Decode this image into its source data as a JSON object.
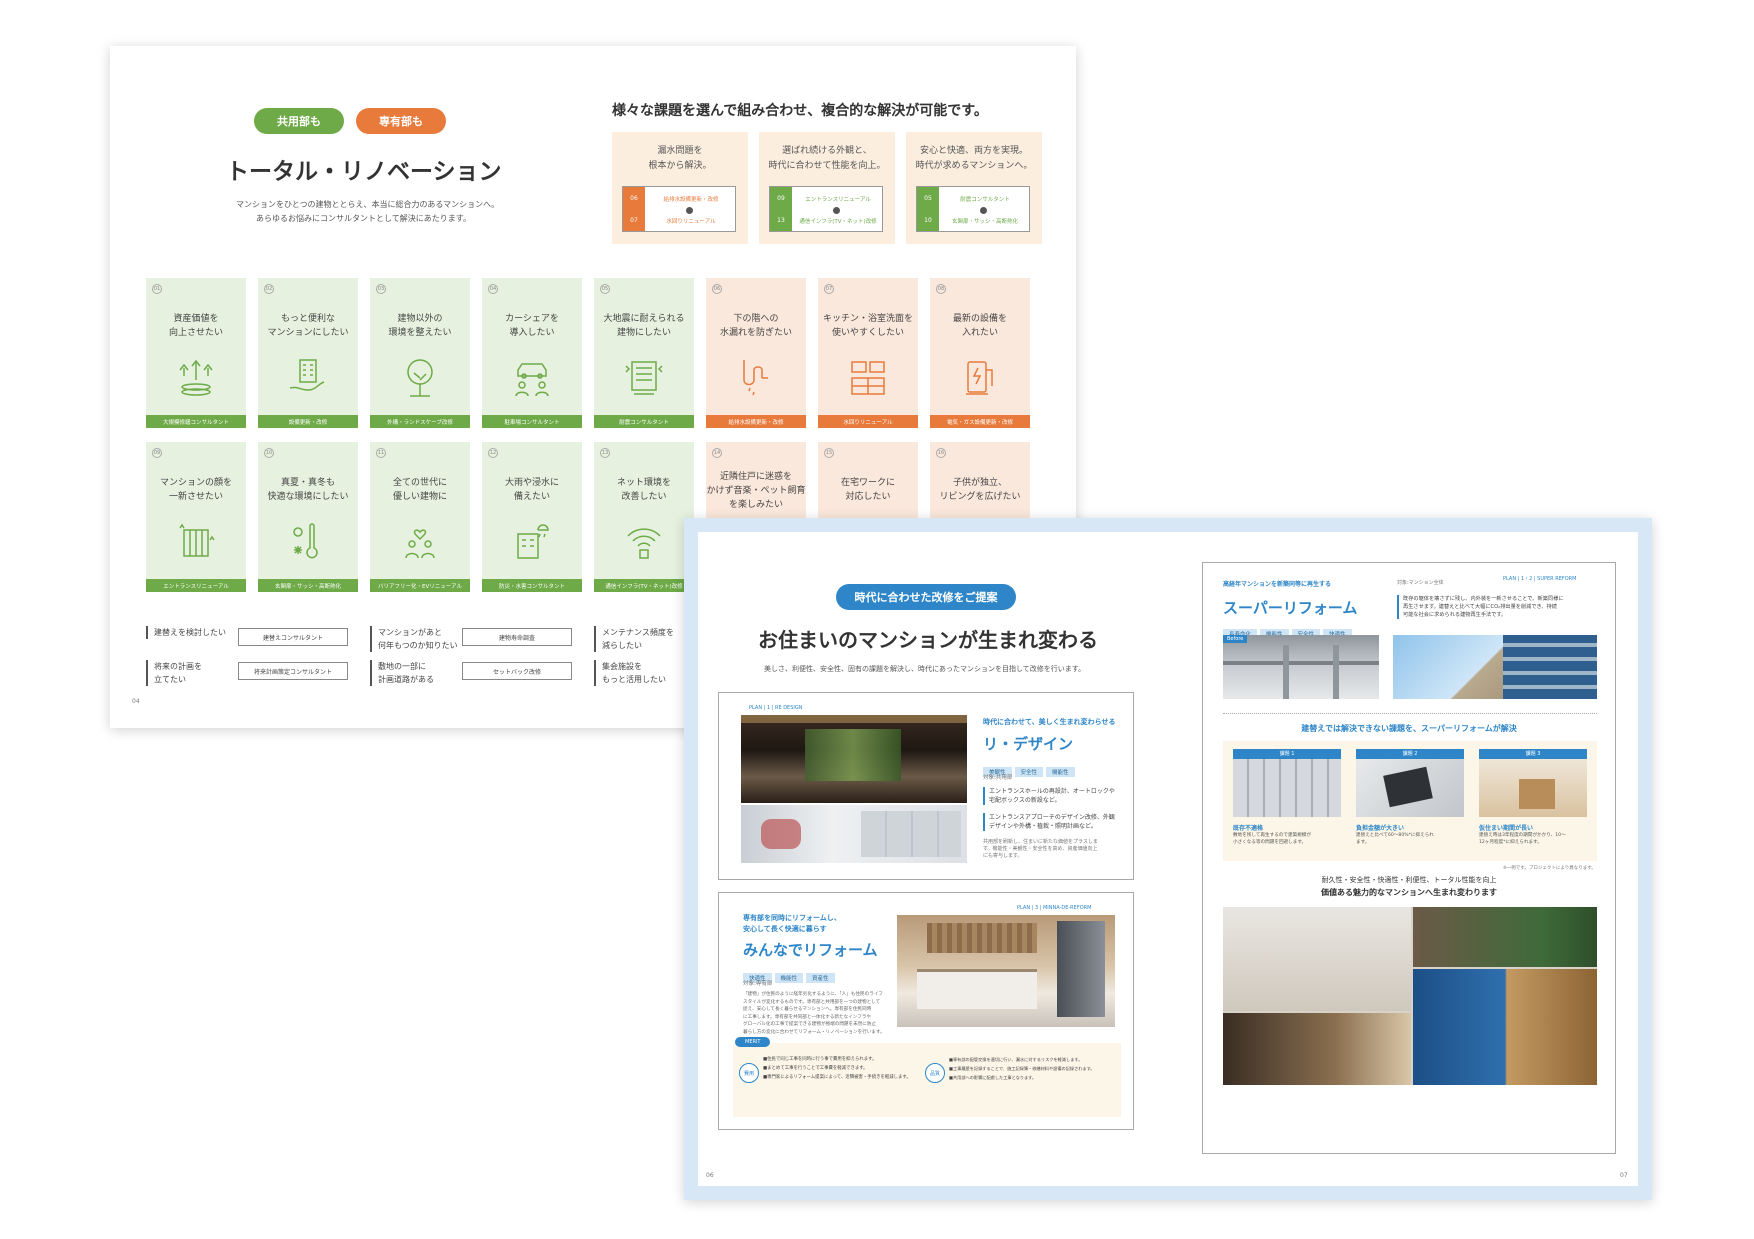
{
  "back": {
    "pills": [
      "共用部も",
      "専有部も"
    ],
    "title": "トータル・リノベーション",
    "lead": [
      "マンションをひとつの建物ととらえ、本当に総合力のあるマンションへ。",
      "あらゆるお悩みにコンサルタントとして解決にあたります。"
    ],
    "headline": "様々な課題を選んで組み合わせ、複合的な解決が可能です。",
    "combos": [
      {
        "l1": "漏水問題を",
        "l2": "根本から解決。",
        "n1": "06",
        "n2": "07",
        "r1": "給排水設備更新・改修",
        "r2": "水回りリニューアル",
        "color": "#e87a3c"
      },
      {
        "l1": "選ばれ続ける外観と、",
        "l2": "時代に合わせて性能を向上。",
        "n1": "09",
        "n2": "13",
        "r1": "エントランスリニューアル",
        "r2": "通信インフラ(TV・ネット)改修",
        "color": "#6eaa48"
      },
      {
        "l1": "安心と快適、両方を実現。",
        "l2": "時代が求めるマンションへ。",
        "n1": "05",
        "n2": "10",
        "r1": "耐震コンサルタント",
        "r2": "玄関扉・サッシ・高断熱化",
        "color": "#6eaa48"
      }
    ],
    "row1": [
      {
        "n": "01",
        "l1": "資産価値を",
        "l2": "向上させたい",
        "bar": "大規模修繕コンサルタント",
        "c": "g",
        "icon": "rising-coins-icon"
      },
      {
        "n": "02",
        "l1": "もっと便利な",
        "l2": "マンションにしたい",
        "bar": "設備更新・改修",
        "c": "g",
        "icon": "building-hand-icon"
      },
      {
        "n": "03",
        "l1": "建物以外の",
        "l2": "環境を整えたい",
        "bar": "外構・ランドスケープ改修",
        "c": "g",
        "icon": "tree-icon"
      },
      {
        "n": "04",
        "l1": "カーシェアを",
        "l2": "導入したい",
        "bar": "駐車場コンサルタント",
        "c": "g",
        "icon": "car-people-icon"
      },
      {
        "n": "05",
        "l1": "大地震に耐えられる",
        "l2": "建物にしたい",
        "bar": "耐震コンサルタント",
        "c": "g",
        "icon": "quake-building-icon"
      },
      {
        "n": "06",
        "l1": "下の階への",
        "l2": "水漏れを防ぎたい",
        "bar": "給排水設備更新・改修",
        "c": "o",
        "icon": "pipe-leak-icon"
      },
      {
        "n": "07",
        "l1": "キッチン・浴室洗面を",
        "l2": "使いやすくしたい",
        "bar": "水回りリニューアル",
        "c": "o",
        "icon": "kitchen-icon"
      },
      {
        "n": "08",
        "l1": "最新の設備を",
        "l2": "入れたい",
        "bar": "電気・ガス設備更新・改修",
        "c": "o",
        "icon": "ev-charger-icon"
      }
    ],
    "row2": [
      {
        "n": "09",
        "l1": "マンションの顔を",
        "l2": "一新させたい",
        "l3": "",
        "bar": "エントランスリニューアル",
        "c": "g",
        "icon": "entrance-icon"
      },
      {
        "n": "10",
        "l1": "真夏・真冬も",
        "l2": "快適な環境にしたい",
        "l3": "",
        "bar": "玄関扉・サッシ・高断熱化",
        "c": "g",
        "icon": "thermometer-icon"
      },
      {
        "n": "11",
        "l1": "全ての世代に",
        "l2": "優しい建物に",
        "l3": "",
        "bar": "バリアフリー化・EVリニューアル",
        "c": "g",
        "icon": "family-heart-icon"
      },
      {
        "n": "12",
        "l1": "大雨や浸水に",
        "l2": "備えたい",
        "l3": "",
        "bar": "防災・水害コンサルタント",
        "c": "g",
        "icon": "rain-building-icon"
      },
      {
        "n": "13",
        "l1": "ネット環境を",
        "l2": "改善したい",
        "l3": "",
        "bar": "通信インフラ(TV・ネット)改修",
        "c": "g",
        "icon": "wifi-icon"
      },
      {
        "n": "14",
        "l1": "近隣住戸に迷惑を",
        "l2": "かけず音楽・ペット飼育",
        "l3": "を楽しみたい",
        "bar": "",
        "c": "o",
        "icon": ""
      },
      {
        "n": "15",
        "l1": "在宅ワークに",
        "l2": "対応したい",
        "l3": "",
        "bar": "",
        "c": "o",
        "icon": ""
      },
      {
        "n": "16",
        "l1": "子供が独立、",
        "l2": "リビングを広げたい",
        "l3": "",
        "bar": "",
        "c": "o",
        "icon": ""
      }
    ],
    "questions": [
      {
        "l1": "建替えを検討したい",
        "l2": "",
        "a": "建替えコンサルタント"
      },
      {
        "l1": "将来の計画を",
        "l2": "立てたい",
        "a": "将来計画策定コンサルタント"
      },
      {
        "l1": "マンションがあと",
        "l2": "何年もつのか知りたい",
        "a": "建物寿命調査"
      },
      {
        "l1": "敷地の一部に",
        "l2": "計画道路がある",
        "a": "セットバック改修"
      },
      {
        "l1": "メンテナンス頻度を",
        "l2": "減らしたい",
        "a": ""
      },
      {
        "l1": "集会施設を",
        "l2": "もっと活用したい",
        "a": ""
      }
    ],
    "page": "04"
  },
  "front": {
    "pill": "時代に合わせた改修をご提案",
    "title": "お住まいのマンションが生まれ変わる",
    "lead": "美しさ、利便性、安全性、固有の課題を解決し、時代にあったマンションを目指して改修を行います。",
    "redesign": {
      "plan": "PLAN | 1 | RE DESIGN",
      "sub": "時代に合わせて、美しく生まれ変わらせる",
      "title": "リ・デザイン",
      "tags": [
        "美観性",
        "安全性",
        "機能性"
      ],
      "target": "対象:共用部",
      "b1": [
        "エントランスホールの再設計、オートロックや",
        "宅配ボックスの新設など。"
      ],
      "b2": [
        "エントランスアプローチのデザイン改修、外観",
        "デザインや外構・植栽・照明計画など。"
      ],
      "body": [
        "共用部を刷新し、住まいに新たな価値をプラスしま",
        "す。機能性・美観性・安全性を高め、資産価値向上",
        "にも寄与します。"
      ]
    },
    "minna": {
      "plan": "PLAN | 3 | MINNA-DE-REFORM",
      "sub1": "専有部を同時にリフォームし、",
      "sub2": "安心して長く快適に暮らす",
      "title": "みんなでリフォーム",
      "tags": [
        "快適性",
        "機能性",
        "資産性"
      ],
      "target": "対象:専有部",
      "body": [
        "「建物」が住民のように経年劣化するように、「人」も住民のライフ",
        "スタイルが変化するものです。専有部と共用部を一つの建物として",
        "捉え、安心して長く暮らせるマンションへ。専有部を住民同時",
        "に工事します。専有部を共同部と一体化する新たなインフラや",
        "グローバル化の工事で提案できる建物が極端の問題を未然に防止",
        "暮らし方の変化に合わせてリフォーム・リノベーションを行います。"
      ],
      "merit": "MERIT",
      "m1": "費用",
      "m1lines": [
        "■住民で同じ工事を同時に行う事で費用を抑えられます。",
        "■まとめて工事を行うことで工事費を軽減できます。",
        "■専門家によるリフォーム提案によって、近隣被害・手続きを軽減します。"
      ],
      "m2": "品質",
      "m2lines": [
        "■専有部の配管交換を適切に行い、漏水に対するリスクを軽減します。",
        "■工事履歴を記録することで、施工記録簿・修繕材料や設備の記録されます。",
        "■共用部への影響に配慮した工事となります。"
      ]
    },
    "superreform": {
      "sub": "高経年マンションを新築同等に再生する",
      "plan": "PLAN | 1・2 | SUPER REFORM",
      "target": "対象:マンション全体",
      "title": "スーパーリフォーム",
      "tags": [
        "長寿命化",
        "機能性",
        "安全性",
        "快適性"
      ],
      "before": "Before",
      "body": [
        "既存の躯体を壊さずに残し、内外装を一新させることで、新築同様に",
        "再生させます。建替えと比べて大幅にCO₂排出量を削減でき、持続",
        "可能な社会に求められる建物再生手法です。"
      ]
    },
    "issues_title": "建替えでは解決できない課題を、スーパーリフォームが解決",
    "issues": [
      {
        "label": "課題 1",
        "title": "既存不適格",
        "text": [
          "敷地を残して再生するので建築規模が",
          "小さくなる等の問題を回避します。"
        ]
      },
      {
        "label": "課題 2",
        "title": "負担金額が大きい",
        "text": [
          "建替えと比べて60〜80%*に抑えられ",
          "ます。"
        ]
      },
      {
        "label": "課題 3",
        "title": "仮住まい期間が長い",
        "text": [
          "建替え時は3年程度の期間がかかり、10〜",
          "12ヶ月程度*に抑えられます。"
        ]
      }
    ],
    "note": "※一例です。プロジェクトにより異なります。",
    "closing1": "耐久性・安全性・快適性・利便性、トータル性能を向上",
    "closing2": "価値ある魅力的なマンションへ生まれ変わります",
    "page_left": "06",
    "page_right": "07"
  }
}
